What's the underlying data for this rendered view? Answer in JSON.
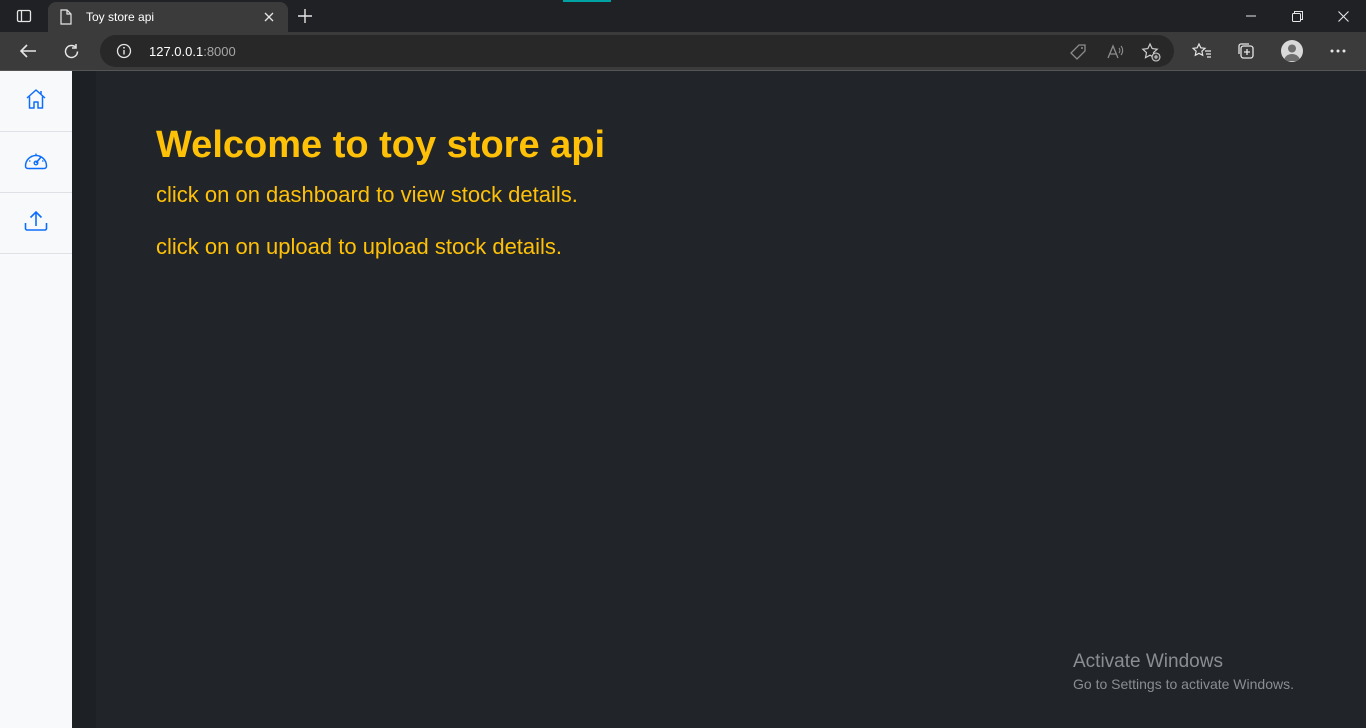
{
  "browser": {
    "tab_title": "Toy store api",
    "url_host": "127.0.0.1",
    "url_port": ":8000"
  },
  "sidebar": {
    "items": [
      {
        "icon": "home-icon"
      },
      {
        "icon": "dashboard-icon"
      },
      {
        "icon": "upload-icon"
      }
    ]
  },
  "main": {
    "heading": "Welcome to toy store api",
    "line1": "click on on dashboard to view stock details.",
    "line2": "click on on upload to upload stock details."
  },
  "watermark": {
    "title": "Activate Windows",
    "subtitle": "Go to Settings to activate Windows."
  },
  "colors": {
    "accent": "#ffc107",
    "page_bg": "#212529",
    "sidebar_bg": "#f8f9fa",
    "sidebar_icon": "#0d6efd"
  }
}
